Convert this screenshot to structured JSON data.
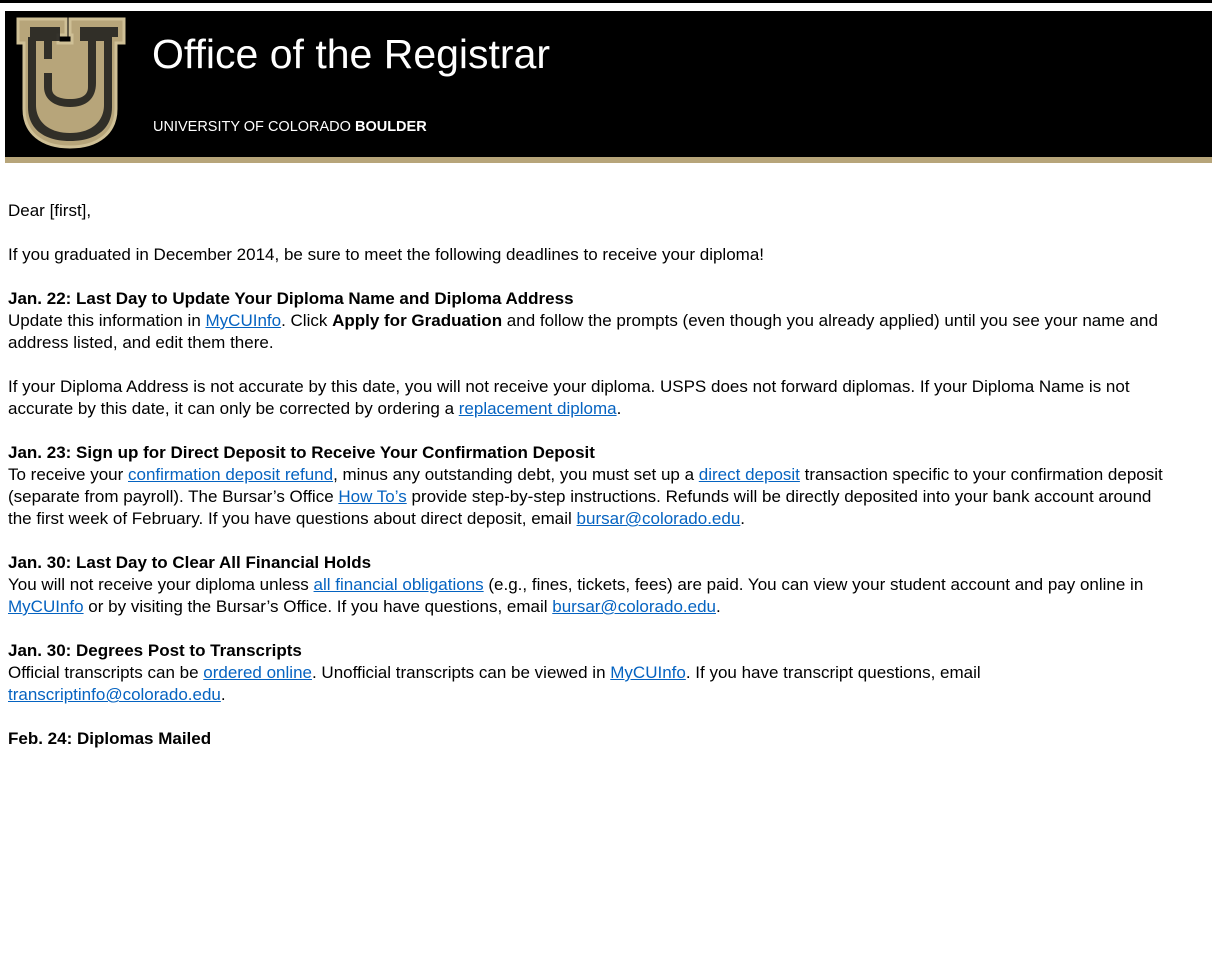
{
  "header": {
    "title": "Office of the Registrar",
    "subtitle_prefix": "UNIVERSITY OF COLORADO ",
    "subtitle_bold": "BOULDER",
    "colors": {
      "banner": "#000000",
      "gold": "#b7a57a",
      "link": "#0563c1"
    }
  },
  "email": {
    "greeting": "Dear [first],",
    "intro": "If you graduated in December 2014, be sure to meet the following deadlines to receive your diploma!",
    "s1": {
      "heading": "Jan. 22: Last Day to Update Your Diploma Name and Diploma Address",
      "p1_a": "Update this information in ",
      "p1_link": "MyCUInfo",
      "p1_b": ". Click ",
      "p1_bold": "Apply for Graduation",
      "p1_c": " and follow the prompts (even though you already applied) until you see your name and address listed, and edit them there.",
      "p2_a": "If your Diploma Address is not accurate by this date, you will not receive your diploma. USPS does not forward diplomas. If your Diploma Name is not accurate by this date, it can only be corrected by ordering a ",
      "p2_link": "replacement diploma",
      "p2_b": "."
    },
    "s2": {
      "heading": "Jan. 23: Sign up for Direct Deposit to Receive Your Confirmation Deposit",
      "a": "To receive your ",
      "link1": "confirmation deposit refund",
      "b": ", minus any outstanding debt, you must set up a ",
      "link2": "direct deposit",
      "c": " transaction specific to your confirmation deposit (separate from payroll). The Bursar’s Office ",
      "link3": "How To’s",
      "d": " provide step-by-step instructions. Refunds will be directly deposited into your bank account around the first week of February. If you have questions about direct deposit, email ",
      "link4": "bursar@colorado.edu",
      "e": "."
    },
    "s3": {
      "heading": "Jan. 30: Last Day to Clear All Financial Holds",
      "a": "You will not receive your diploma unless ",
      "link1": "all financial obligations",
      "b": " (e.g., fines, tickets, fees) are paid. You can view your student account and pay online in ",
      "link2": "MyCUInfo",
      "c": " or by visiting the Bursar’s Office. If you have questions, email ",
      "link3": "bursar@colorado.edu",
      "d": "."
    },
    "s4": {
      "heading": "Jan. 30: Degrees Post to Transcripts",
      "a": "Official transcripts can be ",
      "link1": "ordered online",
      "b": ". Unofficial transcripts can be viewed in ",
      "link2": "MyCUInfo",
      "c": ". If you have transcript questions, email ",
      "link3": "transcriptinfo@colorado.edu",
      "d": "."
    },
    "s5": {
      "heading": "Feb. 24: Diplomas Mailed"
    }
  }
}
